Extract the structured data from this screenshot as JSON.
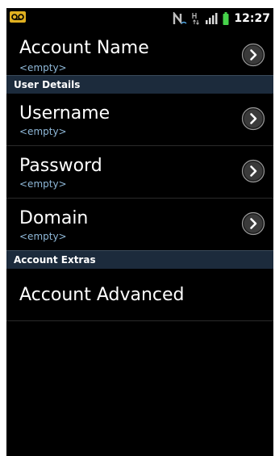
{
  "status_bar": {
    "time": "12:27",
    "icons": [
      "voicemail-icon",
      "nfc-icon",
      "data-hspa-icon",
      "signal-icon",
      "battery-icon"
    ],
    "voicemail_color": "#e0b020",
    "battery_color": "#46d24a"
  },
  "settings": {
    "account_name": {
      "title": "Account Name",
      "summary": "<empty>"
    },
    "sections": [
      {
        "header": "User Details",
        "items": [
          {
            "title": "Username",
            "summary": "<empty>"
          },
          {
            "title": "Password",
            "summary": "<empty>"
          },
          {
            "title": "Domain",
            "summary": "<empty>"
          }
        ]
      },
      {
        "header": "Account Extras",
        "items": [
          {
            "title": "Account Advanced"
          }
        ]
      }
    ]
  },
  "colors": {
    "background": "#000000",
    "section_header_bg": "#1c2b3c",
    "summary_text": "#8fb8d8"
  }
}
